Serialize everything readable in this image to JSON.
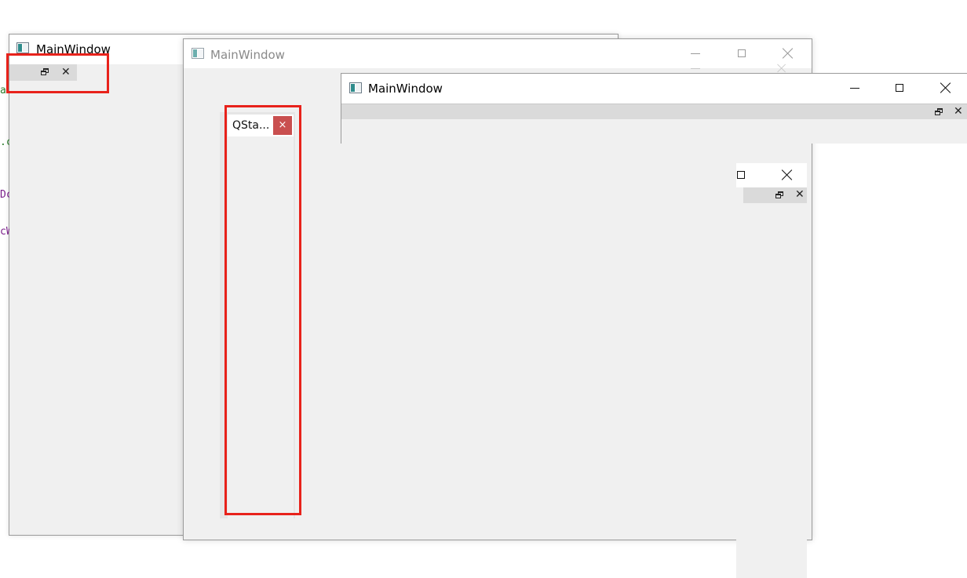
{
  "windows": {
    "back": {
      "title": "MainWindow"
    },
    "middle": {
      "title": "MainWindow"
    },
    "front": {
      "title": "MainWindow"
    }
  },
  "dock_tab": {
    "label": "QSta...",
    "close_glyph": "×"
  },
  "dock_close_glyph": "✕",
  "code_fragments": [
    "a",
    ".c",
    "Dc",
    "cW"
  ],
  "colors": {
    "highlight": "#e8221b",
    "tab_close_bg": "#c94f4f",
    "dock_titlebar": "#dadada",
    "client": "#f0f0f0"
  }
}
